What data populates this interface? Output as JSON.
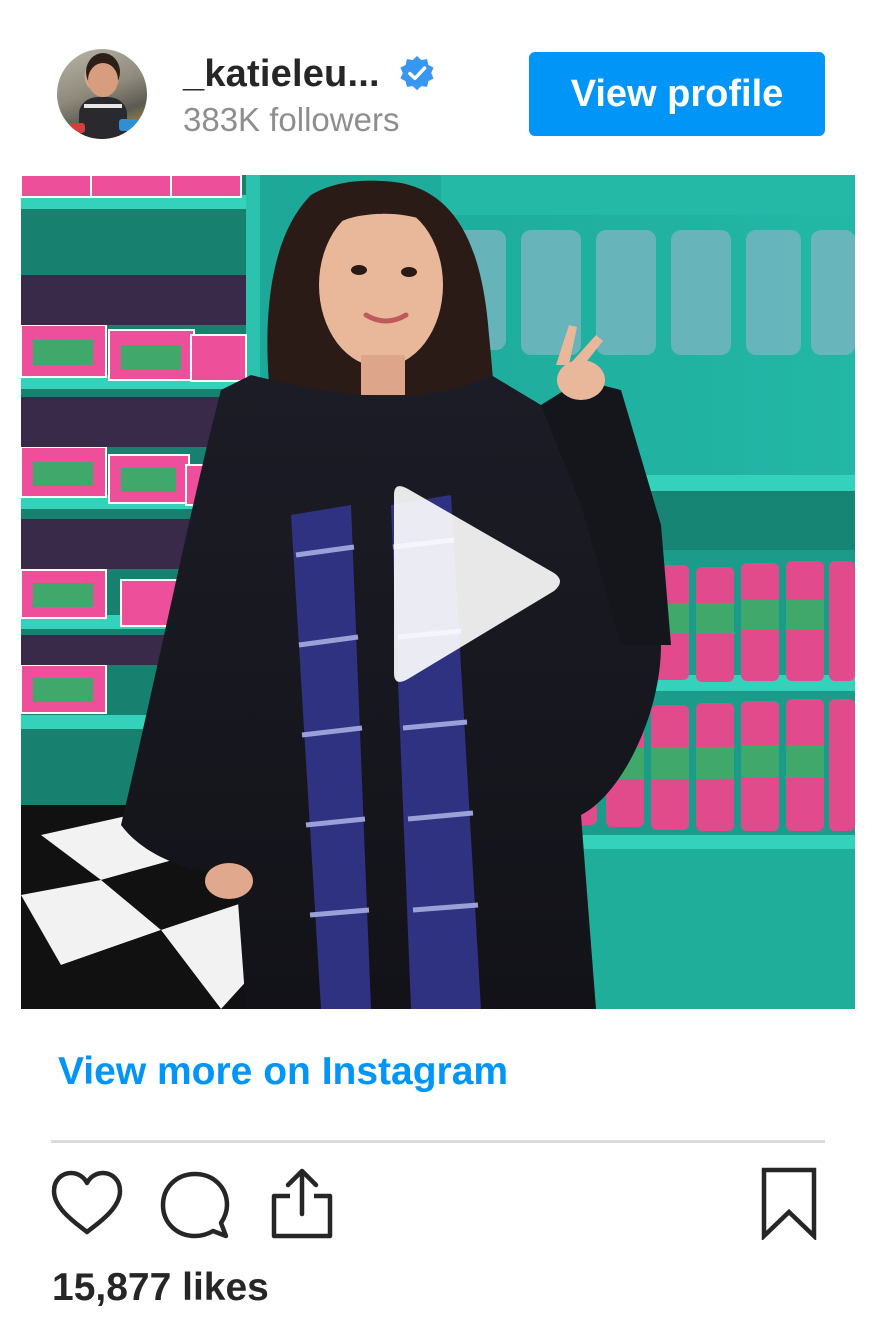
{
  "profile": {
    "username": "_katieleu...",
    "verified": true,
    "followers": "383K followers",
    "view_profile_label": "View profile",
    "avatar_icon": "profile-avatar"
  },
  "media": {
    "type": "video",
    "play_icon": "play-icon"
  },
  "footer": {
    "view_more_label": "View more on Instagram",
    "likes": "15,877 likes",
    "actions": [
      "heart-icon",
      "comment-icon",
      "share-icon",
      "bookmark-icon"
    ]
  },
  "colors": {
    "accent": "#0095f6",
    "text": "#262626",
    "muted": "#8e8e8e",
    "divider": "#dbdbdb",
    "verified_badge": "#3897f0"
  }
}
